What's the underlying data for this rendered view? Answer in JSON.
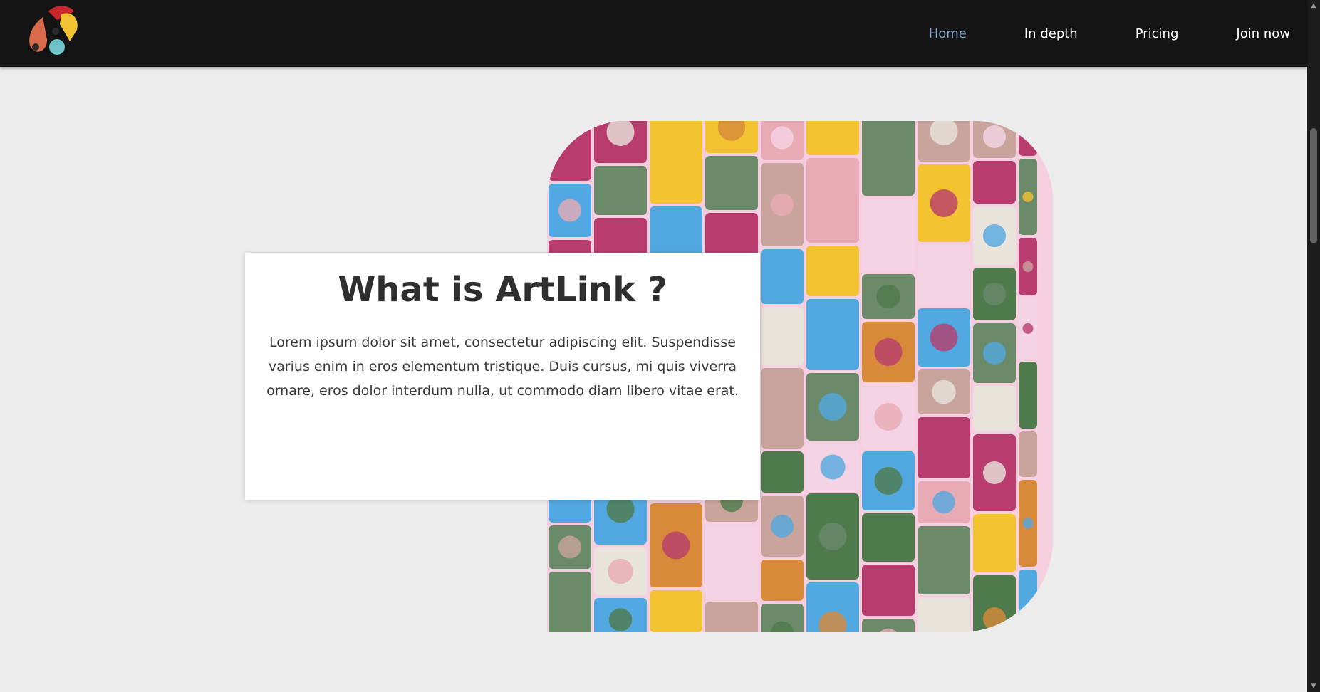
{
  "nav": {
    "logo": {
      "icon": "artlink-logo-icon"
    },
    "links": [
      {
        "label": "Home",
        "active": true
      },
      {
        "label": "In depth",
        "active": false
      },
      {
        "label": "Pricing",
        "active": false
      },
      {
        "label": "Join now",
        "active": false
      }
    ]
  },
  "hero": {
    "title": "What is ArtLink ?",
    "body": "Lorem ipsum dolor sit amet, consectetur adipiscing elit. Suspendisse varius enim in eros elementum tristique. Duis cursus, mi quis viverra ornare, eros dolor interdum nulla, ut commodo diam libero vitae erat."
  },
  "colors": {
    "nav_background": "#141414",
    "nav_active": "#7fa3c8",
    "page_background": "#ececec",
    "collage_palette": [
      "#e8aab4",
      "#c9a49c",
      "#e8e4dc",
      "#f2c230",
      "#52a8e0",
      "#b83d6e",
      "#4f7a4c",
      "#d88a3a",
      "#f4d4e4",
      "#6a8a6a"
    ]
  }
}
